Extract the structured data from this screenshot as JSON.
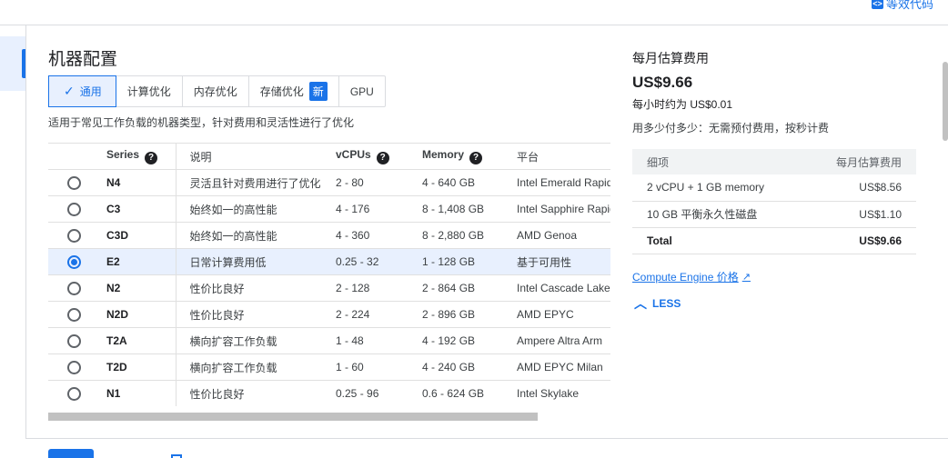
{
  "topbar": {
    "equiv_code_label": "等效代码"
  },
  "machine_config": {
    "title": "机器配置",
    "tabs": [
      {
        "label": "通用",
        "active": true
      },
      {
        "label": "计算优化"
      },
      {
        "label": "内存优化"
      },
      {
        "label": "存储优化",
        "badge": "新"
      },
      {
        "label": "GPU"
      }
    ],
    "subtitle": "适用于常见工作负载的机器类型，针对费用和灵活性进行了优化",
    "table": {
      "headers": {
        "series": "Series",
        "desc": "说明",
        "vcpus": "vCPUs",
        "memory": "Memory",
        "platform": "平台"
      },
      "rows": [
        {
          "series": "N4",
          "desc": "灵活且针对费用进行了优化",
          "vcpus": "2 - 80",
          "memory": "4 - 640 GB",
          "platform": "Intel Emerald Rapids",
          "selected": false
        },
        {
          "series": "C3",
          "desc": "始终如一的高性能",
          "vcpus": "4 - 176",
          "memory": "8 - 1,408 GB",
          "platform": "Intel Sapphire Rapids",
          "selected": false
        },
        {
          "series": "C3D",
          "desc": "始终如一的高性能",
          "vcpus": "4 - 360",
          "memory": "8 - 2,880 GB",
          "platform": "AMD Genoa",
          "selected": false
        },
        {
          "series": "E2",
          "desc": "日常计算费用低",
          "vcpus": "0.25 - 32",
          "memory": "1 - 128 GB",
          "platform": "基于可用性",
          "selected": true
        },
        {
          "series": "N2",
          "desc": "性价比良好",
          "vcpus": "2 - 128",
          "memory": "2 - 864 GB",
          "platform": "Intel Cascade Lake",
          "selected": false
        },
        {
          "series": "N2D",
          "desc": "性价比良好",
          "vcpus": "2 - 224",
          "memory": "2 - 896 GB",
          "platform": "AMD EPYC",
          "selected": false
        },
        {
          "series": "T2A",
          "desc": "横向扩容工作负载",
          "vcpus": "1 - 48",
          "memory": "4 - 192 GB",
          "platform": "Ampere Altra Arm",
          "selected": false
        },
        {
          "series": "T2D",
          "desc": "横向扩容工作负载",
          "vcpus": "1 - 60",
          "memory": "4 - 240 GB",
          "platform": "AMD EPYC Milan",
          "selected": false
        },
        {
          "series": "N1",
          "desc": "性价比良好",
          "vcpus": "0.25 - 96",
          "memory": "0.6 - 624 GB",
          "platform": "Intel Skylake",
          "selected": false
        }
      ]
    }
  },
  "cost": {
    "title": "每月估算费用",
    "amount": "US$9.66",
    "hourly": "每小时约为 US$0.01",
    "note": "用多少付多少：无需预付费用，按秒计费",
    "table": {
      "headers": {
        "item": "细项",
        "monthly": "每月估算费用"
      },
      "rows": [
        {
          "item": "2 vCPU + 1 GB memory",
          "monthly": "US$8.56"
        },
        {
          "item": "10 GB 平衡永久性磁盘",
          "monthly": "US$1.10"
        }
      ],
      "total": {
        "item": "Total",
        "monthly": "US$9.66"
      }
    },
    "link_label": "Compute Engine 价格",
    "less_label": "LESS"
  }
}
